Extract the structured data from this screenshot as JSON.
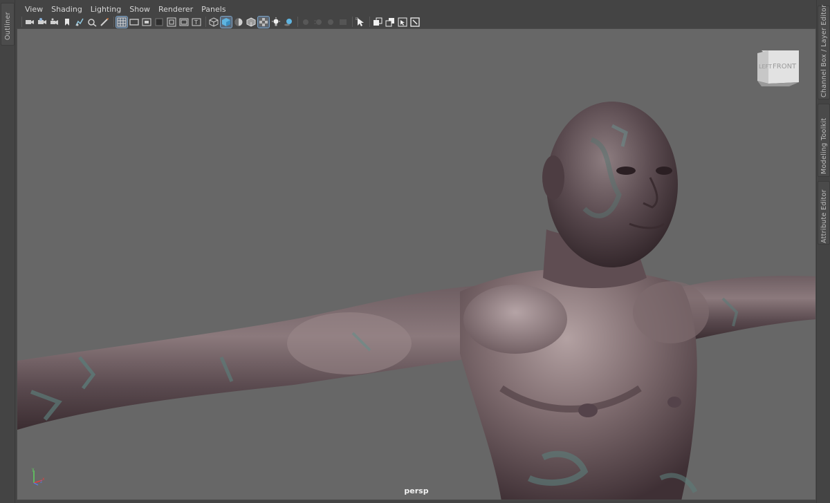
{
  "left_panel": {
    "tab_label": "Outliner"
  },
  "right_panel": {
    "tabs": [
      {
        "label": "Channel Box / Layer Editor"
      },
      {
        "label": "Modeling Toolkit"
      },
      {
        "label": "Attribute Editor"
      }
    ]
  },
  "menubar": {
    "items": [
      "View",
      "Shading",
      "Lighting",
      "Show",
      "Renderer",
      "Panels"
    ]
  },
  "toolbar": {
    "icons": [
      "select-camera-icon",
      "camera-attributes-icon",
      "bookmarks-icon",
      "image-plane-icon",
      "grease-pencil-icon",
      "2d-pan-zoom-icon",
      "grid-icon",
      "film-gate-icon",
      "resolution-gate-icon",
      "gate-mask-icon",
      "field-chart-icon",
      "safe-action-icon",
      "safe-title-icon",
      "wireframe-icon",
      "smooth-shade-icon",
      "default-material-icon",
      "shaded-wireframe-icon",
      "textured-icon",
      "use-lights-icon",
      "shadows-icon",
      "screen-space-ao-icon",
      "motion-blur-icon",
      "multisample-aa-icon",
      "depth-of-field-icon",
      "isolate-select-icon",
      "xray-icon",
      "xray-joints-icon",
      "xray-components-icon",
      "frame-selection-icon"
    ]
  },
  "viewport": {
    "camera_label": "persp",
    "viewcube": {
      "left_face": "LEFT",
      "front_face": "FRONT"
    },
    "background_color": "#676767",
    "axis": {
      "x_color": "#e04040",
      "y_color": "#5fd35f",
      "z_color": "#5a7ae0"
    }
  }
}
